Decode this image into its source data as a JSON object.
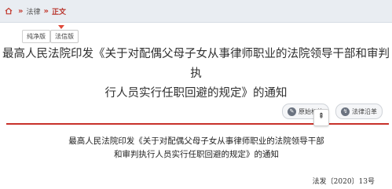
{
  "breadcrumb": {
    "items": [
      "法律",
      "正文"
    ],
    "separator": "»"
  },
  "version_tabs": {
    "pure": "纯净版",
    "fancy": "法信版"
  },
  "title_lines": [
    "最高人民法院印发《关于对配偶父母子女从事律师职业的法院领导干部和审判执",
    "行人员实行任职回避的规定》的通知"
  ],
  "tools": {
    "annotate_label": "原始标签",
    "history_label": "法律沿革"
  },
  "back_to_top": "⇞",
  "document": {
    "title_lines": [
      "最高人民法院印发《关于对配偶父母子女从事律师职业的法院领导干部",
      "和审判执行人员实行任职回避的规定》的通知"
    ],
    "number": "法发〔2020〕13号"
  },
  "colors": {
    "accent_red": "#c8312a",
    "topbar_bg": "#e9edf2"
  }
}
